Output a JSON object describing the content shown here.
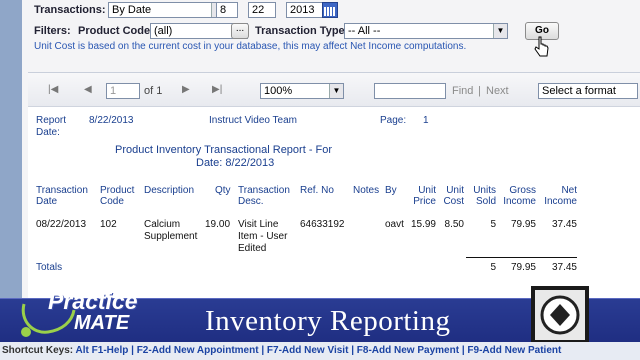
{
  "filters": {
    "transactions_label": "Transactions:",
    "transactions_value": "By Date",
    "date_month": "8",
    "date_day": "22",
    "date_year": "2013",
    "filters_label": "Filters:",
    "product_code_label": "Product Code:",
    "product_code_value": "(all)",
    "ellipsis": "...",
    "transaction_type_label": "Transaction Type:",
    "transaction_type_value": "-- All --",
    "go_label": "Go",
    "note": "Unit Cost is based on the current cost in your database, this may affect Net Income computations."
  },
  "toolbar": {
    "page_value": "1",
    "of_label": "of 1",
    "zoom": "100%",
    "find_label": "Find",
    "separator": "|",
    "next_label": "Next",
    "format": "Select a format"
  },
  "report": {
    "date_label": "Report Date:",
    "date_label_1": "Report",
    "date_label_2": "Date:",
    "date_value": "8/22/2013",
    "org": "Instruct Video Team",
    "page_label": "Page:",
    "page_value": "1",
    "title_line1": "Product Inventory Transactional Report - For",
    "title_line2": "Date: 8/22/2013",
    "headers": [
      [
        "Transaction",
        "Date"
      ],
      [
        "Product",
        "Code"
      ],
      [
        "Description",
        ""
      ],
      [
        "Qty",
        ""
      ],
      [
        "Transaction",
        "Desc."
      ],
      [
        "Ref. No",
        ""
      ],
      [
        "Notes",
        ""
      ],
      [
        "By",
        ""
      ],
      [
        "Unit",
        "Price"
      ],
      [
        "Unit",
        "Cost"
      ],
      [
        "Units",
        "Sold"
      ],
      [
        "Gross",
        "Income"
      ],
      [
        "Net",
        "Income"
      ]
    ],
    "row": {
      "date": "08/22/2013",
      "code": "102",
      "desc1": "Calcium",
      "desc2": "Supplement",
      "qty": "19.00",
      "tdesc1": "Visit Line",
      "tdesc2": "Item - User",
      "tdesc3": "Edited",
      "ref": "64633192",
      "by": "oavt",
      "unit_price": "15.99",
      "unit_cost": "8.50",
      "units_sold": "5",
      "gross": "79.95",
      "net": "37.45"
    },
    "totals": {
      "label": "Totals",
      "units_sold": "5",
      "gross": "79.95",
      "net": "37.45"
    }
  },
  "banner": {
    "logo_top": "Practice",
    "logo_bottom": "MATE",
    "title": "Inventory Reporting"
  },
  "shortcuts": {
    "label": "Shortcut Keys:",
    "items": [
      "Alt F1-Help",
      "|",
      "F2-Add New Appointment",
      "|",
      "F7-Add New Visit",
      "|",
      "F8-Add New Payment",
      "|",
      "F9-Add New Patient"
    ]
  },
  "colors": {
    "accent": "#2956b2",
    "banner": "#22318a"
  }
}
